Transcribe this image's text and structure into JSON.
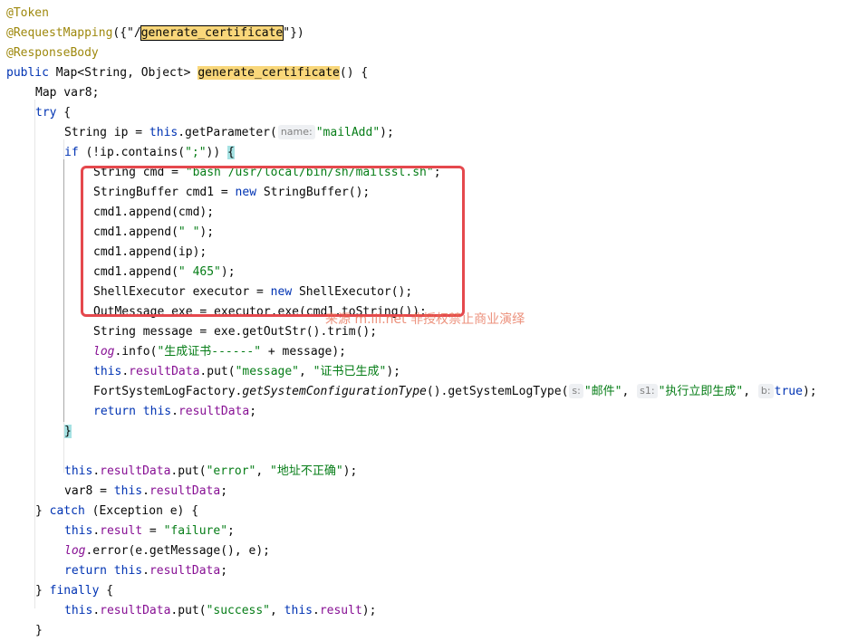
{
  "editor": {
    "lines": [
      {
        "indent": 0,
        "tokens": [
          {
            "t": "@Token",
            "c": "anno"
          }
        ]
      },
      {
        "indent": 0,
        "tokens": [
          {
            "t": "@RequestMapping",
            "c": "anno"
          },
          {
            "t": "({\"/"
          },
          {
            "t": "generate_certificate",
            "c": "hl-box"
          },
          {
            "t": "\"})"
          }
        ]
      },
      {
        "indent": 0,
        "tokens": [
          {
            "t": "@ResponseBody",
            "c": "anno"
          }
        ]
      },
      {
        "indent": 0,
        "tokens": [
          {
            "t": "public ",
            "c": "kw"
          },
          {
            "t": "Map<String, Object> "
          },
          {
            "t": "generate_certificate",
            "c": "hl"
          },
          {
            "t": "() {"
          }
        ]
      },
      {
        "indent": 1,
        "tokens": [
          {
            "t": "Map var8;"
          }
        ]
      },
      {
        "indent": 1,
        "tokens": [
          {
            "t": "try",
            "c": "kw"
          },
          {
            "t": " {"
          }
        ]
      },
      {
        "indent": 2,
        "tokens": [
          {
            "t": "String ip = "
          },
          {
            "t": "this",
            "c": "kw"
          },
          {
            "t": ".getParameter("
          },
          {
            "hint": "name:"
          },
          {
            "t": "\"mailAdd\"",
            "c": "str"
          },
          {
            "t": ");"
          }
        ]
      },
      {
        "indent": 2,
        "tokens": [
          {
            "t": "if",
            "c": "kw"
          },
          {
            "t": " (!ip.contains("
          },
          {
            "t": "\";\"",
            "c": "str"
          },
          {
            "t": ")) "
          },
          {
            "t": "{",
            "c": "brace"
          }
        ]
      },
      {
        "indent": 3,
        "tokens": [
          {
            "t": "String cmd = "
          },
          {
            "t": "\"bash /usr/local/bin/sh/mailssl.sh\"",
            "c": "str"
          },
          {
            "t": ";"
          }
        ]
      },
      {
        "indent": 3,
        "tokens": [
          {
            "t": "StringBuffer cmd1 = "
          },
          {
            "t": "new ",
            "c": "kw"
          },
          {
            "t": "StringBuffer();"
          }
        ]
      },
      {
        "indent": 3,
        "tokens": [
          {
            "t": "cmd1.append(cmd);"
          }
        ]
      },
      {
        "indent": 3,
        "tokens": [
          {
            "t": "cmd1.append("
          },
          {
            "t": "\" \"",
            "c": "str"
          },
          {
            "t": ");"
          }
        ]
      },
      {
        "indent": 3,
        "tokens": [
          {
            "t": "cmd1.append(ip);"
          }
        ]
      },
      {
        "indent": 3,
        "tokens": [
          {
            "t": "cmd1.append("
          },
          {
            "t": "\" 465\"",
            "c": "str"
          },
          {
            "t": ");"
          }
        ]
      },
      {
        "indent": 3,
        "tokens": [
          {
            "t": "ShellExecutor executor = "
          },
          {
            "t": "new ",
            "c": "kw"
          },
          {
            "t": "ShellExecutor();"
          }
        ]
      },
      {
        "indent": 3,
        "tokens": [
          {
            "t": "OutMessage exe = executor.exe(cmd1.toString());"
          }
        ]
      },
      {
        "indent": 3,
        "tokens": [
          {
            "t": "String message = exe.getOutStr().trim();"
          }
        ]
      },
      {
        "indent": 3,
        "tokens": [
          {
            "t": "log",
            "c": "field-italic"
          },
          {
            "t": ".info("
          },
          {
            "t": "\"生成证书------\"",
            "c": "str"
          },
          {
            "t": " + message);"
          }
        ]
      },
      {
        "indent": 3,
        "tokens": [
          {
            "t": "this",
            "c": "kw"
          },
          {
            "t": "."
          },
          {
            "t": "resultData",
            "c": "field"
          },
          {
            "t": ".put("
          },
          {
            "t": "\"message\"",
            "c": "str"
          },
          {
            "t": ", "
          },
          {
            "t": "\"证书已生成\"",
            "c": "str"
          },
          {
            "t": ");"
          }
        ]
      },
      {
        "indent": 3,
        "tokens": [
          {
            "t": "FortSystemLogFactory."
          },
          {
            "t": "getSystemConfigurationType",
            "c": "italic"
          },
          {
            "t": "().getSystemLogType("
          },
          {
            "hint": "s:"
          },
          {
            "t": "\"邮件\"",
            "c": "str"
          },
          {
            "t": ", "
          },
          {
            "hint": "s1:"
          },
          {
            "t": "\"执行立即生成\"",
            "c": "str"
          },
          {
            "t": ", "
          },
          {
            "hint": "b:"
          },
          {
            "t": "true",
            "c": "kw"
          },
          {
            "t": ");"
          }
        ]
      },
      {
        "indent": 3,
        "tokens": [
          {
            "t": "return ",
            "c": "kw"
          },
          {
            "t": "this",
            "c": "kw"
          },
          {
            "t": "."
          },
          {
            "t": "resultData",
            "c": "field"
          },
          {
            "t": ";"
          }
        ]
      },
      {
        "indent": 2,
        "tokens": [
          {
            "t": "}",
            "c": "brace"
          }
        ]
      },
      {
        "indent": 0,
        "tokens": []
      },
      {
        "indent": 2,
        "tokens": [
          {
            "t": "this",
            "c": "kw"
          },
          {
            "t": "."
          },
          {
            "t": "resultData",
            "c": "field"
          },
          {
            "t": ".put("
          },
          {
            "t": "\"error\"",
            "c": "str"
          },
          {
            "t": ", "
          },
          {
            "t": "\"地址不正确\"",
            "c": "str"
          },
          {
            "t": ");"
          }
        ]
      },
      {
        "indent": 2,
        "tokens": [
          {
            "t": "var8 = "
          },
          {
            "t": "this",
            "c": "kw"
          },
          {
            "t": "."
          },
          {
            "t": "resultData",
            "c": "field"
          },
          {
            "t": ";"
          }
        ]
      },
      {
        "indent": 1,
        "tokens": [
          {
            "t": "} "
          },
          {
            "t": "catch",
            "c": "kw"
          },
          {
            "t": " (Exception e) {"
          }
        ]
      },
      {
        "indent": 2,
        "tokens": [
          {
            "t": "this",
            "c": "kw"
          },
          {
            "t": "."
          },
          {
            "t": "result",
            "c": "field"
          },
          {
            "t": " = "
          },
          {
            "t": "\"failure\"",
            "c": "str"
          },
          {
            "t": ";"
          }
        ]
      },
      {
        "indent": 2,
        "tokens": [
          {
            "t": "log",
            "c": "field-italic"
          },
          {
            "t": ".error(e.getMessage(), e);"
          }
        ]
      },
      {
        "indent": 2,
        "tokens": [
          {
            "t": "return ",
            "c": "kw"
          },
          {
            "t": "this",
            "c": "kw"
          },
          {
            "t": "."
          },
          {
            "t": "resultData",
            "c": "field"
          },
          {
            "t": ";"
          }
        ]
      },
      {
        "indent": 1,
        "tokens": [
          {
            "t": "} "
          },
          {
            "t": "finally",
            "c": "kw"
          },
          {
            "t": " {"
          }
        ]
      },
      {
        "indent": 2,
        "tokens": [
          {
            "t": "this",
            "c": "kw"
          },
          {
            "t": "."
          },
          {
            "t": "resultData",
            "c": "field"
          },
          {
            "t": ".put("
          },
          {
            "t": "\"success\"",
            "c": "str"
          },
          {
            "t": ", "
          },
          {
            "t": "this",
            "c": "kw"
          },
          {
            "t": "."
          },
          {
            "t": "result",
            "c": "field"
          },
          {
            "t": ");"
          }
        ]
      },
      {
        "indent": 1,
        "tokens": [
          {
            "t": "}"
          }
        ]
      }
    ]
  },
  "watermark": {
    "text": "来源 m.iii.net 非授权禁止商业演绎"
  },
  "colors": {
    "keyword": "#0033b3",
    "string": "#067d17",
    "annotation": "#9e880d",
    "field": "#871094",
    "highlight": "#f9d77a",
    "brace_match": "#a6e2e3",
    "red_box": "#e5484d"
  }
}
